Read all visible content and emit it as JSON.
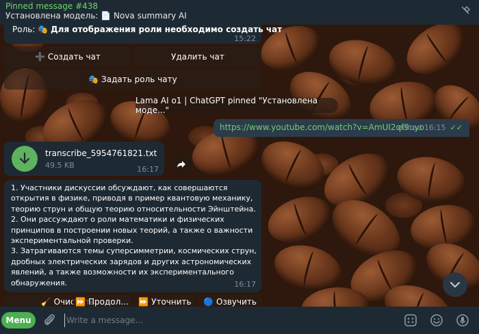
{
  "pinned": {
    "title": "Pinned message #438",
    "text": "Установлена модель: 📄 Nova summary AI"
  },
  "role_message": {
    "label": "Роль: ",
    "emoji": "🎭",
    "bold_text": "Для  отображения  роли  необходимо  создать  чат",
    "time": "15:22"
  },
  "keyboard_top": {
    "create_chat": "➕ Создать чат",
    "delete_chat": "Удалить чат",
    "set_role": "🎭 Задать роль чату"
  },
  "service": {
    "text": "Lama AI o1 | ChatGPT pinned \"Установлена моде...\""
  },
  "outgoing": {
    "link": "https://www.youtube.com/watch?v=AmUI2qf9uyo",
    "edited": "edited 16:15",
    "ticks": "✓✓"
  },
  "file": {
    "name": "transcribe_5954761821.txt",
    "size": "49.5 KB",
    "time": "16:17"
  },
  "summary": {
    "text": "1. Участники дискуссии обсуждают, как совершаются открытия в физике, приводя в пример квантовую механику, теорию струн и общую теорию относительности Эйнштейна.\n2. Они рассуждают о роли математики и физических принципов в построении новых теорий, а также о важности экспериментальной проверки.\n3. Затрагиваются темы суперсимметрии, космических струн, дробных электрических зарядов и других астрономических явлений, а также возможности их экспериментального обнаружения.",
    "time": "16:17"
  },
  "keyboard_bottom": {
    "clear": "Очистить",
    "continue": "⏩ Продол...",
    "clarify": "⏩ Уточнить",
    "voice": "Озвучить"
  },
  "input": {
    "menu_label": "Menu",
    "placeholder": "Write a message..."
  },
  "colors": {
    "accent_green": "#4caf50",
    "link_green": "#6fcf6f",
    "bubble": "#1e2a33",
    "out_bubble": "#2b3b4a"
  }
}
